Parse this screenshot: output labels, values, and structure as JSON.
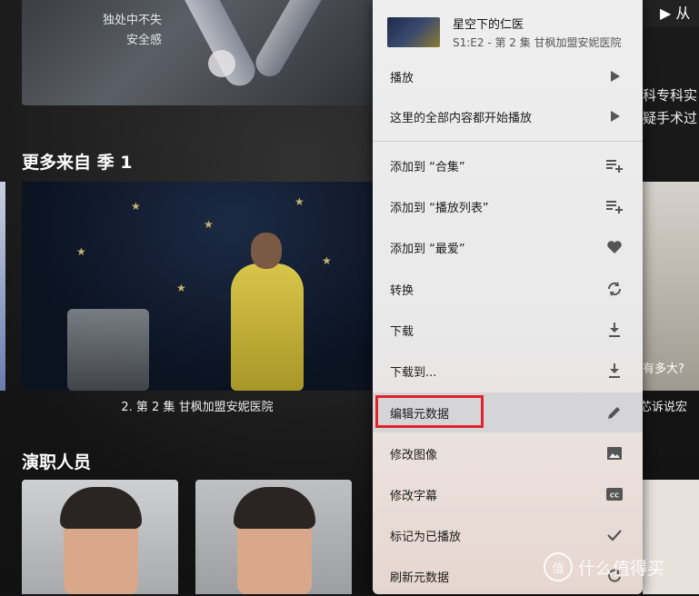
{
  "background": {
    "top_caption_line1": "独处中不失",
    "top_caption_line2": "安全感",
    "section_more": "更多来自 季 1",
    "episode_caption": "2. 第 2 集 甘枫加盟安妮医院",
    "section_cast": "演职人员",
    "right_button": "从",
    "right_text_1": "科专科实",
    "right_text_2": "疑手术过",
    "right_text_3": "有多大?",
    "right_caption": "芯诉说宏",
    "watermark": "什么值得买",
    "watermark_logo": "值"
  },
  "menu": {
    "title": "星空下的仁医",
    "subtitle": "S1:E2 - 第 2 集 甘枫加盟安妮医院",
    "items": [
      {
        "label": "播放",
        "icon": "play-icon"
      },
      {
        "label": "这里的全部内容都开始播放",
        "icon": "play-icon"
      },
      {
        "label": "添加到 “合集”",
        "icon": "playlist-add-icon"
      },
      {
        "label": "添加到 “播放列表”",
        "icon": "playlist-add-icon"
      },
      {
        "label": "添加到 “最爱”",
        "icon": "heart-icon"
      },
      {
        "label": "转换",
        "icon": "sync-icon"
      },
      {
        "label": "下载",
        "icon": "download-icon"
      },
      {
        "label": "下载到...",
        "icon": "download-icon"
      },
      {
        "label": "编辑元数据",
        "icon": "pencil-icon"
      },
      {
        "label": "修改图像",
        "icon": "image-icon"
      },
      {
        "label": "修改字幕",
        "icon": "subtitles-icon"
      },
      {
        "label": "标记为已播放",
        "icon": "check-icon"
      },
      {
        "label": "刷新元数据",
        "icon": "refresh-icon"
      }
    ]
  },
  "colors": {
    "highlight_border": "#e0242b",
    "menu_background": "#eeeeee",
    "icon": "#555555"
  }
}
